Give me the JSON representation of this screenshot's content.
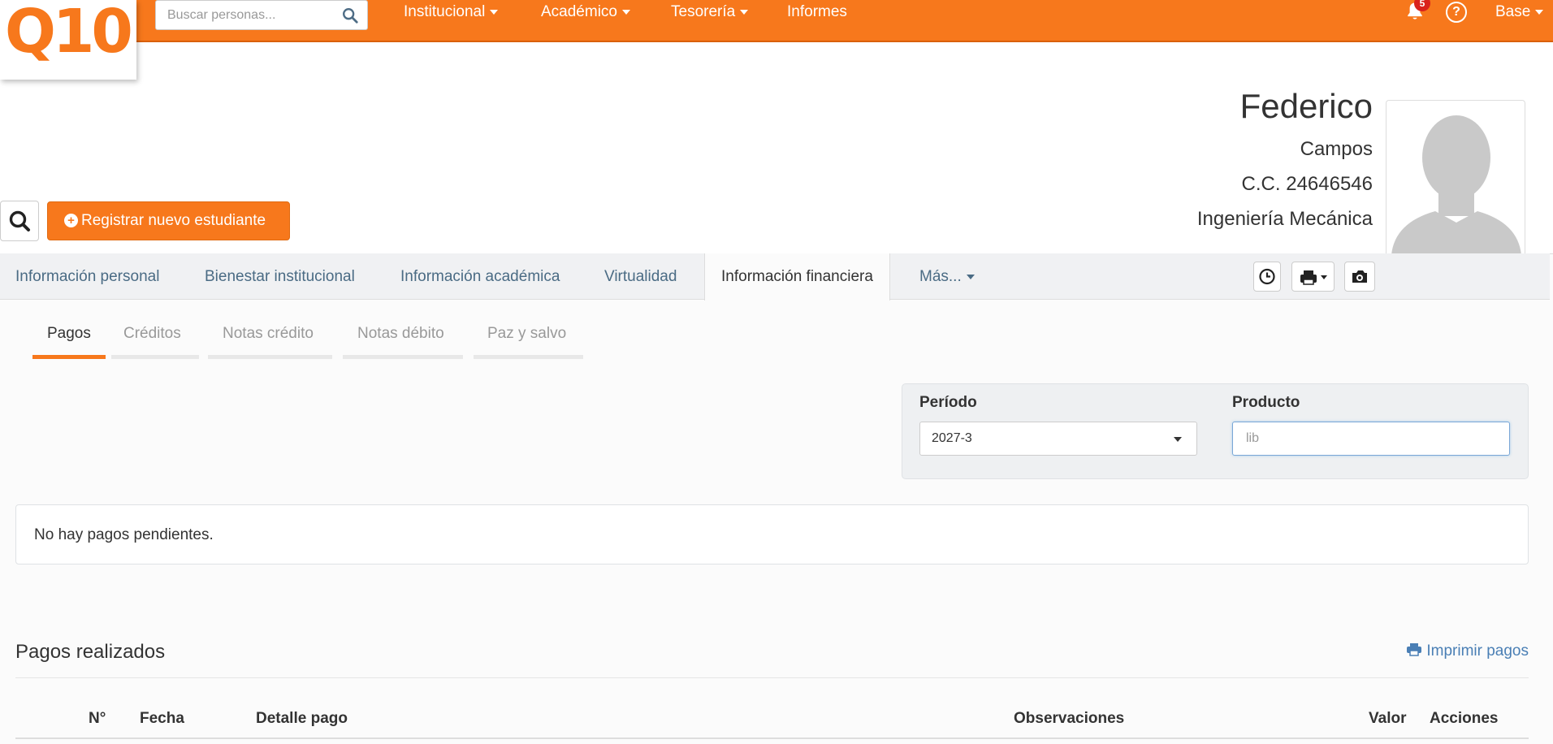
{
  "brand": {
    "logo_text": "Q10",
    "accent": "#f7781c"
  },
  "topnav": {
    "search_placeholder": "Buscar personas...",
    "menu": [
      {
        "label": "Institucional",
        "dropdown": true
      },
      {
        "label": "Académico",
        "dropdown": true
      },
      {
        "label": "Tesorería",
        "dropdown": true
      },
      {
        "label": "Informes",
        "dropdown": false
      }
    ],
    "notifications_count": "5",
    "help_glyph": "?",
    "user_menu": "Base"
  },
  "profile": {
    "first_name": "Federico",
    "last_name": "Campos",
    "document": "C.C. 24646546",
    "program": "Ingeniería Mecánica"
  },
  "actions": {
    "register_label": "Registrar nuevo estudiante"
  },
  "tabs": [
    {
      "label": "Información personal",
      "active": false
    },
    {
      "label": "Bienestar institucional",
      "active": false
    },
    {
      "label": "Información académica",
      "active": false
    },
    {
      "label": "Virtualidad",
      "active": false
    },
    {
      "label": "Información financiera",
      "active": true
    },
    {
      "label": "Más...",
      "active": false
    }
  ],
  "subtabs": [
    {
      "label": "Pagos",
      "active": true
    },
    {
      "label": "Créditos",
      "active": false
    },
    {
      "label": "Notas crédito",
      "active": false
    },
    {
      "label": "Notas débito",
      "active": false
    },
    {
      "label": "Paz y salvo",
      "active": false
    }
  ],
  "filters": {
    "period_label": "Período",
    "period_value": "2027-3",
    "product_label": "Producto",
    "product_value": "lib"
  },
  "pending": {
    "message": "No hay pagos pendientes."
  },
  "payments": {
    "title": "Pagos realizados",
    "print_label": "Imprimir pagos",
    "columns": [
      "N°",
      "Fecha",
      "Detalle pago",
      "Observaciones",
      "Valor",
      "Acciones"
    ]
  }
}
